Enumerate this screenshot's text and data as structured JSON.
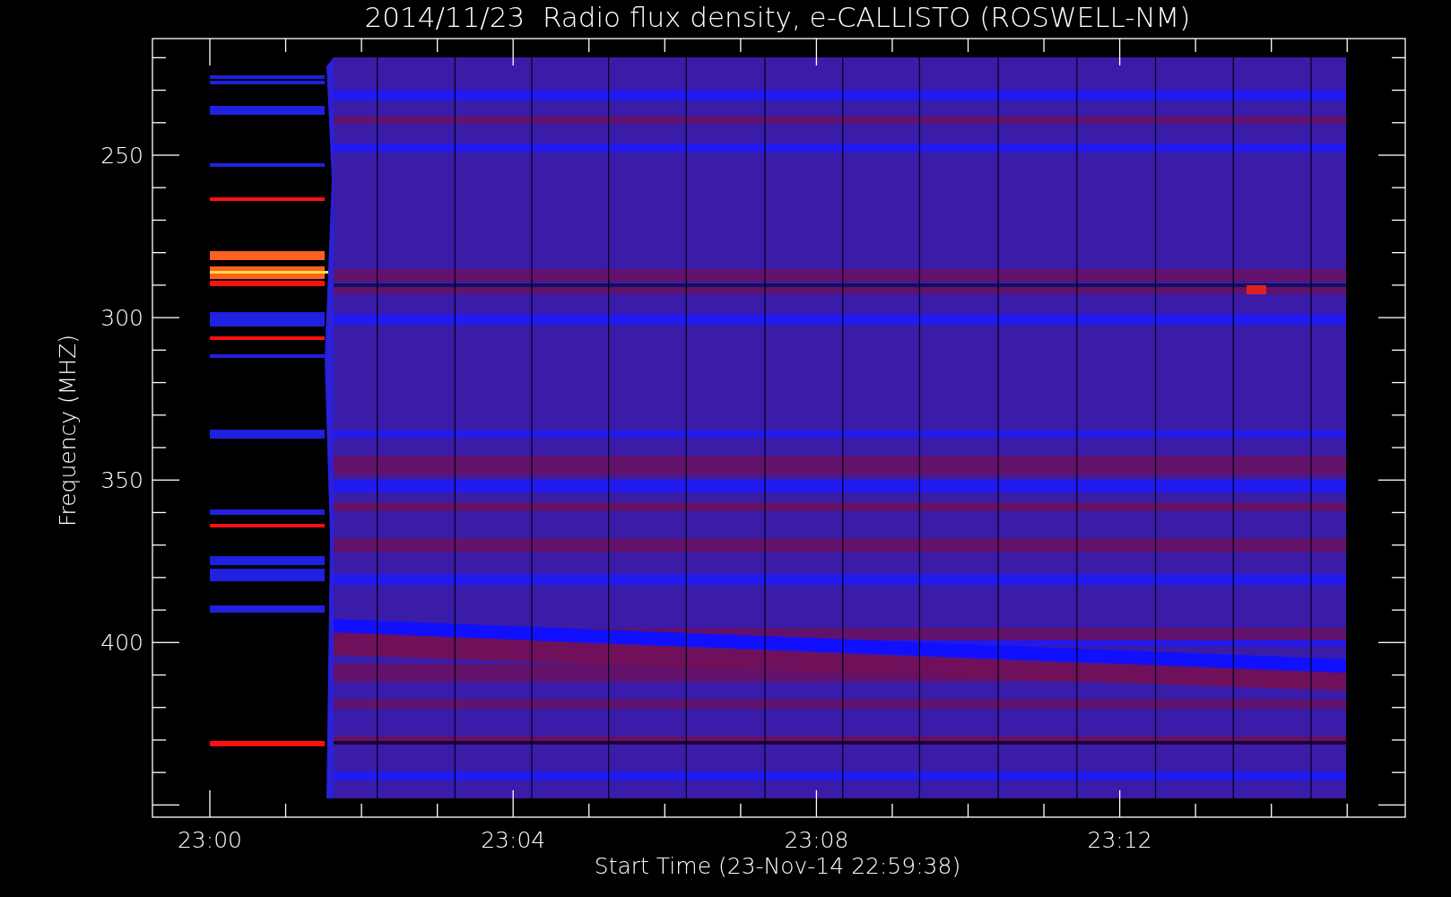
{
  "title": "2014/11/23  Radio flux density, e-CALLISTO (ROSWELL-NM)",
  "plot": {
    "ylabel": "Frequency (MHZ)",
    "xlabel": "Start Time (23-Nov-14 22:59:38)",
    "yticks": [
      "250",
      "300",
      "350",
      "400"
    ],
    "xticks": [
      "23:00",
      "23:04",
      "23:08",
      "23:12"
    ]
  }
}
